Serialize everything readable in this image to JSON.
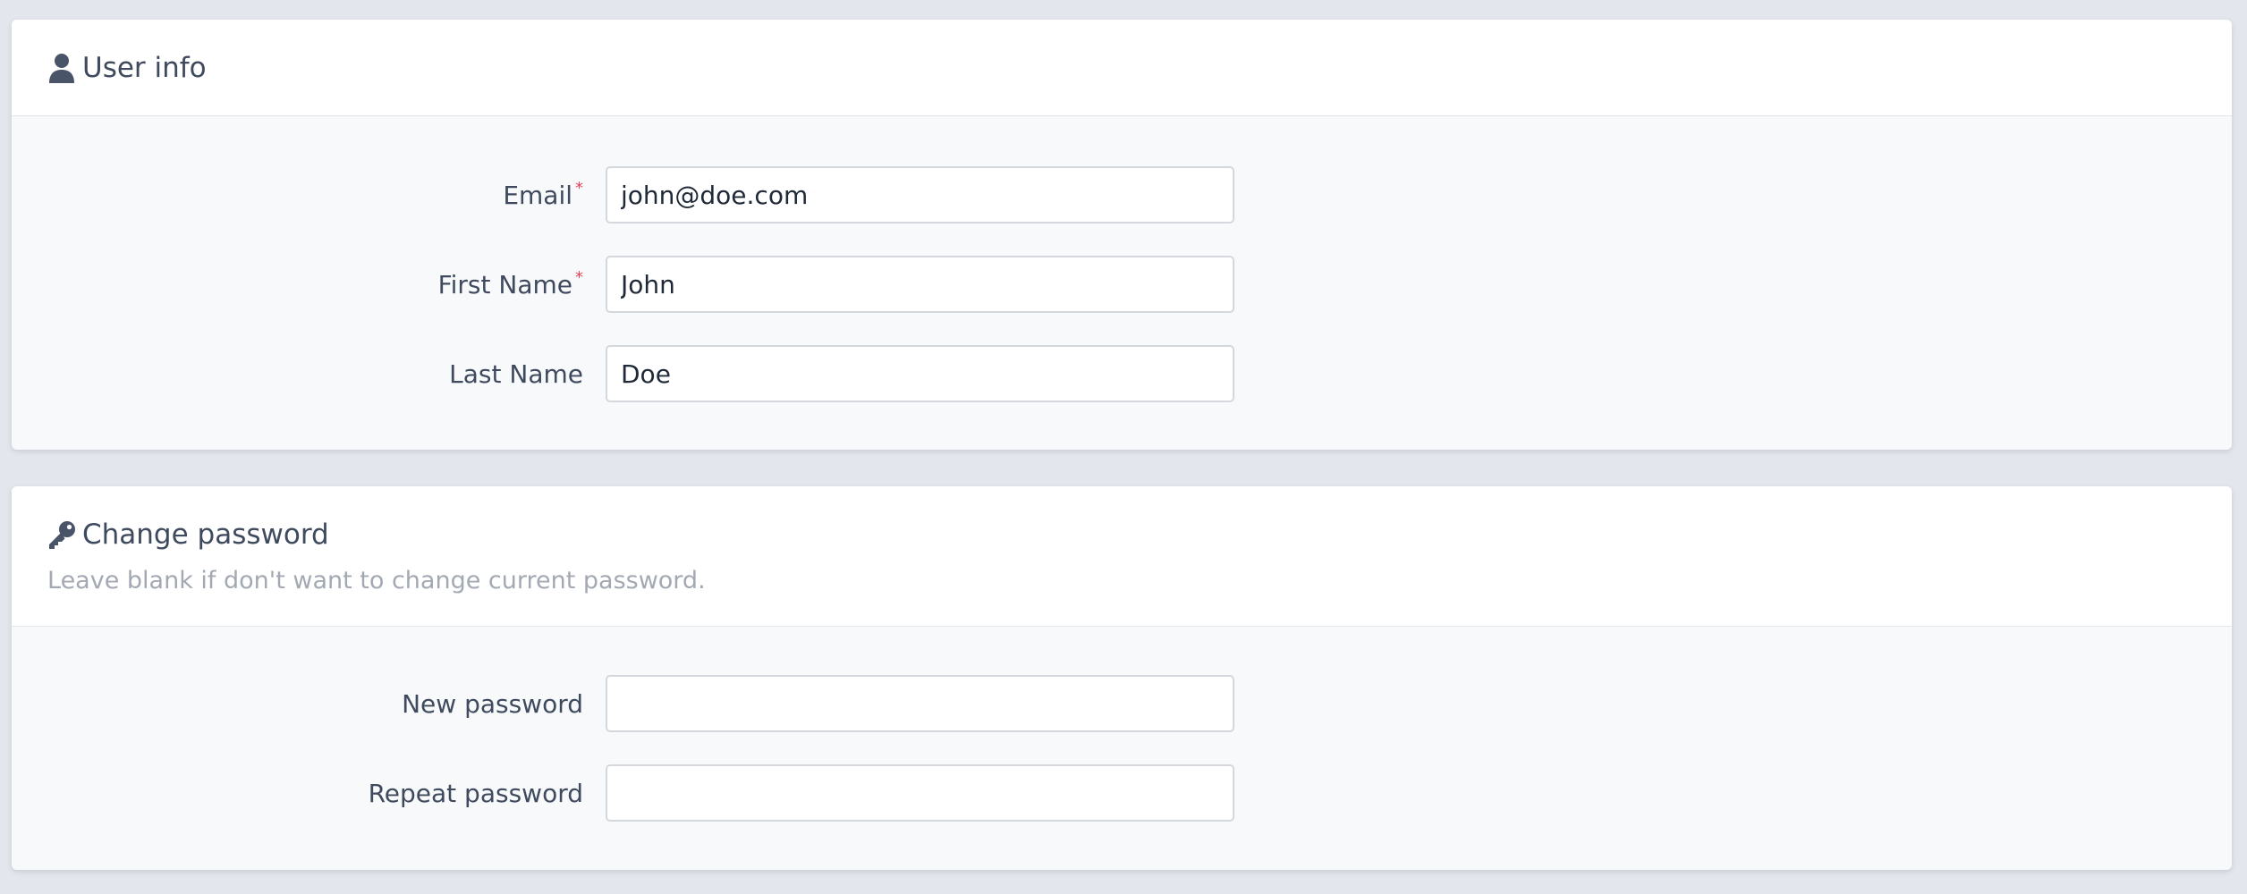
{
  "user_info": {
    "title": "User info",
    "icon": "user-icon",
    "fields": {
      "email": {
        "label": "Email",
        "value": "john@doe.com",
        "required": true
      },
      "first_name": {
        "label": "First Name",
        "value": "John",
        "required": true
      },
      "last_name": {
        "label": "Last Name",
        "value": "Doe",
        "required": false
      }
    }
  },
  "change_password": {
    "title": "Change password",
    "icon": "key-icon",
    "description": "Leave blank if don't want to change current password.",
    "fields": {
      "new_password": {
        "label": "New password",
        "value": ""
      },
      "repeat_password": {
        "label": "Repeat password",
        "value": ""
      }
    }
  },
  "colors": {
    "background": "#e3e6ec",
    "required_mark": "#e0455a",
    "text": "#3f4a5e",
    "muted_text": "#a3a9b3"
  },
  "required_marker": "*"
}
